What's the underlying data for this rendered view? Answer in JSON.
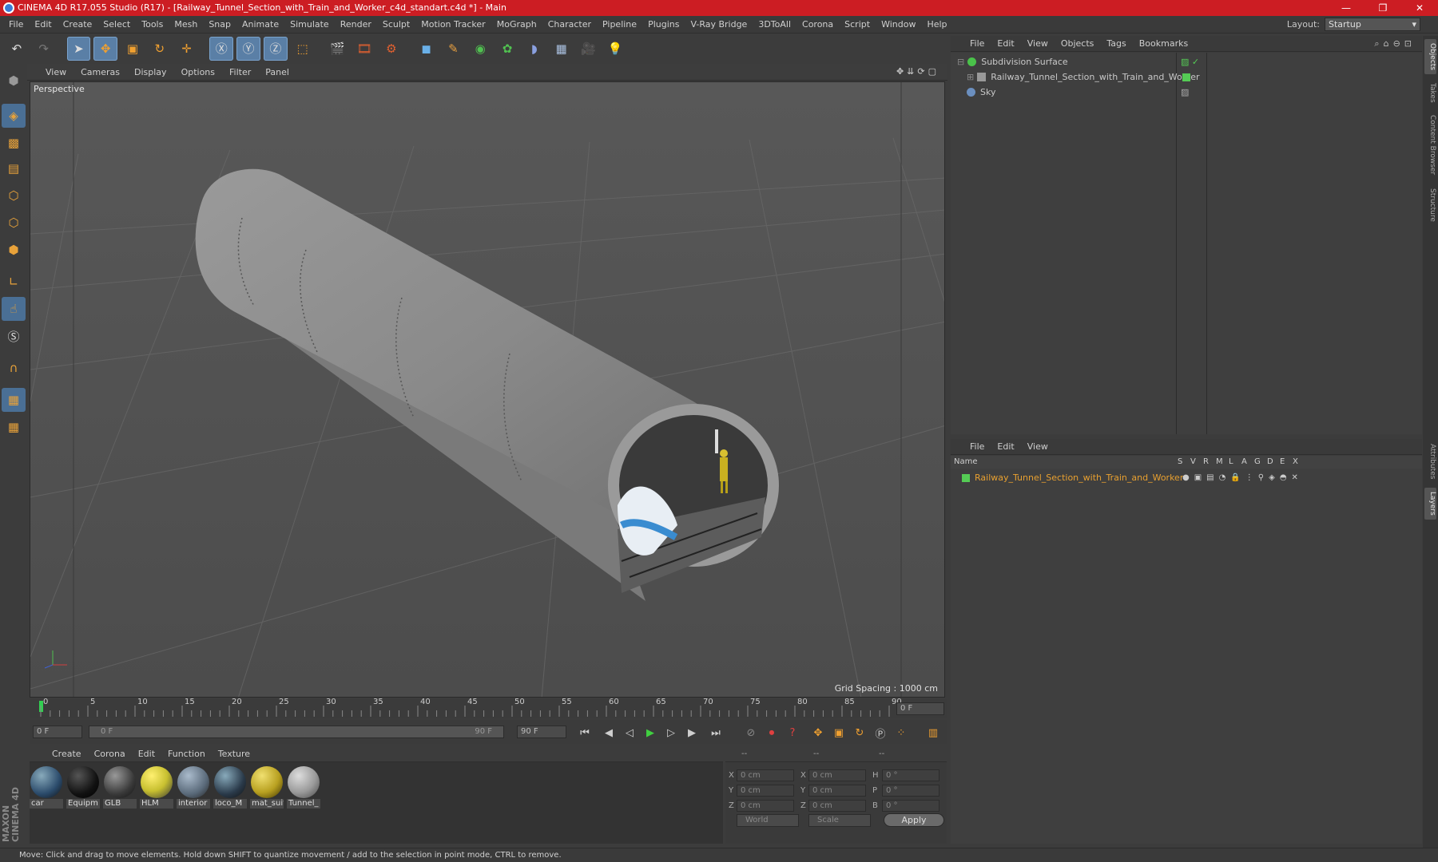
{
  "window": {
    "title": "CINEMA 4D R17.055 Studio (R17) - [Railway_Tunnel_Section_with_Train_and_Worker_c4d_standart.c4d *] - Main",
    "minimize": "—",
    "maximize": "❐",
    "close": "✕"
  },
  "menubar": [
    "File",
    "Edit",
    "Create",
    "Select",
    "Tools",
    "Mesh",
    "Snap",
    "Animate",
    "Simulate",
    "Render",
    "Sculpt",
    "Motion Tracker",
    "MoGraph",
    "Character",
    "Pipeline",
    "Plugins",
    "V-Ray Bridge",
    "3DToAll",
    "Corona",
    "Script",
    "Window",
    "Help"
  ],
  "layout": {
    "label": "Layout:",
    "value": "Startup"
  },
  "toolbar_icons": [
    "undo-icon",
    "redo-icon",
    "select-arrow-icon",
    "move-icon",
    "scale-icon",
    "rotate-icon",
    "transform-icon",
    "x-axis-icon",
    "y-axis-icon",
    "z-axis-icon",
    "coordinate-system-icon",
    "render-view-icon",
    "render-picture-viewer-icon",
    "edit-render-settings-icon",
    "cube-icon",
    "pen-icon",
    "subdivision-icon",
    "array-icon",
    "deformer-icon",
    "floor-icon",
    "camera-icon",
    "light-icon"
  ],
  "viewport": {
    "menu": [
      "View",
      "Cameras",
      "Display",
      "Options",
      "Filter",
      "Panel"
    ],
    "label": "Perspective",
    "grid_spacing": "Grid Spacing : 1000 cm"
  },
  "timeline": {
    "ticks": [
      "0",
      "5",
      "10",
      "15",
      "20",
      "25",
      "30",
      "35",
      "40",
      "45",
      "50",
      "55",
      "60",
      "65",
      "70",
      "75",
      "80",
      "85",
      "90"
    ],
    "current_frame": "0 F",
    "start_field": "0 F",
    "range_start": "0 F",
    "range_end": "90 F",
    "end_field": "90 F"
  },
  "materials": {
    "menu": [
      "Create",
      "Corona",
      "Edit",
      "Function",
      "Texture"
    ],
    "items": [
      {
        "label": "car",
        "color": "#2a4a6a"
      },
      {
        "label": "Equipm",
        "color": "#111111"
      },
      {
        "label": "GLB",
        "color": "#3a3a3a"
      },
      {
        "label": "HLM",
        "color": "#c8c030"
      },
      {
        "label": "interior",
        "color": "#5a6a7a"
      },
      {
        "label": "loco_M",
        "color": "#2a3a4a"
      },
      {
        "label": "mat_suit",
        "color": "#b8a020"
      },
      {
        "label": "Tunnel_",
        "color": "#9a9a9a"
      }
    ]
  },
  "coords": {
    "header": [
      "--",
      "--",
      "--"
    ],
    "rows": [
      {
        "a": "X",
        "av": "0 cm",
        "b": "X",
        "bv": "0 cm",
        "c": "H",
        "cv": "0 °"
      },
      {
        "a": "Y",
        "av": "0 cm",
        "b": "Y",
        "bv": "0 cm",
        "c": "P",
        "cv": "0 °"
      },
      {
        "a": "Z",
        "av": "0 cm",
        "b": "Z",
        "bv": "0 cm",
        "c": "B",
        "cv": "0 °"
      }
    ],
    "mode1": "World",
    "mode2": "Scale",
    "apply": "Apply"
  },
  "objects": {
    "menu": [
      "File",
      "Edit",
      "View",
      "Objects",
      "Tags",
      "Bookmarks"
    ],
    "items": [
      {
        "name": "Subdivision Surface",
        "color": "#4ac24a"
      },
      {
        "name": "Railway_Tunnel_Section_with_Train_and_Worker",
        "color": "#999999"
      },
      {
        "name": "Sky",
        "color": "#6b8fbf"
      }
    ]
  },
  "layers": {
    "menu": [
      "File",
      "Edit",
      "View"
    ],
    "columns": [
      "Name",
      "S",
      "V",
      "R",
      "M",
      "L",
      "A",
      "G",
      "D",
      "E",
      "X"
    ],
    "items": [
      {
        "name": "Railway_Tunnel_Section_with_Train_and_Worker",
        "color": "#e8a030"
      }
    ]
  },
  "right_tabs": [
    "Objects",
    "Takes",
    "Content Browser",
    "Structure",
    "Attributes",
    "Layers"
  ],
  "status": "Move: Click and drag to move elements. Hold down SHIFT to quantize movement / add to the selection in point mode, CTRL to remove.",
  "brand": "MAXON CINEMA 4D"
}
